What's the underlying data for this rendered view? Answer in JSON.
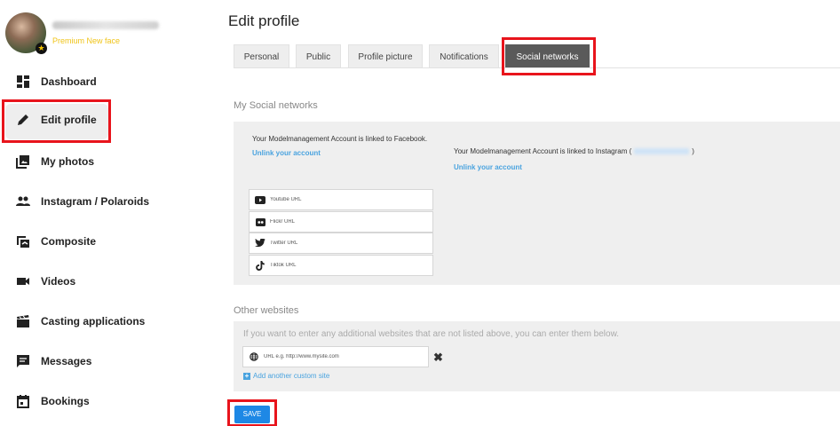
{
  "profile": {
    "status": "Premium New face",
    "badge_icon": "star-icon"
  },
  "sidebar": {
    "items": [
      {
        "label": "Dashboard",
        "icon": "dashboard-icon"
      },
      {
        "label": "Edit profile",
        "icon": "pencil-icon",
        "active": true
      },
      {
        "label": "My photos",
        "icon": "photos-icon"
      },
      {
        "label": "Instagram / Polaroids",
        "icon": "people-icon"
      },
      {
        "label": "Composite",
        "icon": "composite-icon"
      },
      {
        "label": "Videos",
        "icon": "video-camera-icon"
      },
      {
        "label": "Casting applications",
        "icon": "clapperboard-icon"
      },
      {
        "label": "Messages",
        "icon": "message-icon"
      },
      {
        "label": "Bookings",
        "icon": "calendar-icon"
      }
    ]
  },
  "main": {
    "title": "Edit profile",
    "tabs": [
      {
        "label": "Personal"
      },
      {
        "label": "Public"
      },
      {
        "label": "Profile picture"
      },
      {
        "label": "Notifications"
      },
      {
        "label": "Social networks",
        "active": true
      }
    ]
  },
  "social": {
    "section_title": "My Social networks",
    "facebook_text": "Your Modelmanagement Account is linked to Facebook.",
    "facebook_unlink": "Unlink your account",
    "instagram_text_prefix": "Your Modelmanagement Account is linked to Instagram (",
    "instagram_text_suffix": ")",
    "instagram_unlink": "Unlink your account",
    "fields": [
      {
        "placeholder": "Youtube URL",
        "icon": "youtube-icon"
      },
      {
        "placeholder": "Flickr URL",
        "icon": "flickr-icon"
      },
      {
        "placeholder": "Twitter URL",
        "icon": "twitter-icon"
      },
      {
        "placeholder": "Tiktok URL",
        "icon": "tiktok-icon"
      }
    ]
  },
  "websites": {
    "section_title": "Other websites",
    "hint": "If you want to enter any additional websites that are not listed above, you can enter them below.",
    "url_placeholder": "URL e.g. http://www.mysite.com",
    "remove_label": "✖",
    "add_label": "Add another custom site"
  },
  "actions": {
    "save_label": "SAVE"
  },
  "colors": {
    "highlight": "#e8141c",
    "link": "#4aa3df",
    "active_tab": "#5a5a5a",
    "save_button": "#1e88e5",
    "premium": "#f0c419"
  }
}
